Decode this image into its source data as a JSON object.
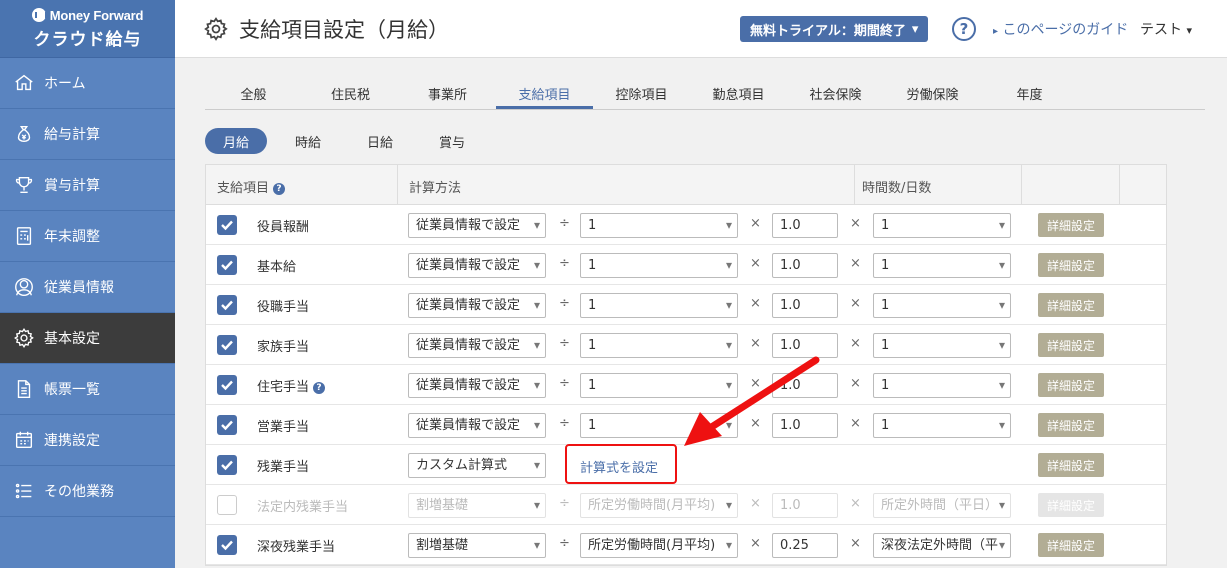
{
  "brand": {
    "logo_text": "Money Forward",
    "product": "クラウド給与"
  },
  "sidebar": {
    "items": [
      {
        "label": "ホーム",
        "icon": "home-icon"
      },
      {
        "label": "給与計算",
        "icon": "money-bag-icon"
      },
      {
        "label": "賞与計算",
        "icon": "trophy-icon"
      },
      {
        "label": "年末調整",
        "icon": "calculator-icon"
      },
      {
        "label": "従業員情報",
        "icon": "person-icon"
      },
      {
        "label": "基本設定",
        "icon": "gear-icon"
      },
      {
        "label": "帳票一覧",
        "icon": "document-icon"
      },
      {
        "label": "連携設定",
        "icon": "calendar-icon"
      },
      {
        "label": "その他業務",
        "icon": "list-icon"
      }
    ],
    "active_index": 5
  },
  "header": {
    "title": "支給項目設定（月給）",
    "trial_label": "無料トライアル：期間終了",
    "help_label": "?",
    "guide_label": "このページのガイド",
    "user_label": "テスト"
  },
  "tabs": [
    "全般",
    "住民税",
    "事業所",
    "支給項目",
    "控除項目",
    "勤怠項目",
    "社会保険",
    "労働保険",
    "年度"
  ],
  "active_tab": 3,
  "subtabs": [
    "月給",
    "時給",
    "日給",
    "賞与"
  ],
  "active_subtab": 0,
  "table": {
    "headers": {
      "item": "支給項目",
      "method": "計算方法",
      "hours": "時間数/日数"
    },
    "detail_label": "詳細設定",
    "formula_label": "計算式を設定",
    "divide_symbol": "÷",
    "times_symbol": "×",
    "rows": [
      {
        "name": "役員報酬",
        "checked": true,
        "help": false,
        "method": "従業員情報で設定",
        "divisor": "1",
        "factor": "1.0",
        "hours": "1"
      },
      {
        "name": "基本給",
        "checked": true,
        "help": false,
        "method": "従業員情報で設定",
        "divisor": "1",
        "factor": "1.0",
        "hours": "1"
      },
      {
        "name": "役職手当",
        "checked": true,
        "help": false,
        "method": "従業員情報で設定",
        "divisor": "1",
        "factor": "1.0",
        "hours": "1"
      },
      {
        "name": "家族手当",
        "checked": true,
        "help": false,
        "method": "従業員情報で設定",
        "divisor": "1",
        "factor": "1.0",
        "hours": "1"
      },
      {
        "name": "住宅手当",
        "checked": true,
        "help": true,
        "method": "従業員情報で設定",
        "divisor": "1",
        "factor": "1.0",
        "hours": "1"
      },
      {
        "name": "営業手当",
        "checked": true,
        "help": false,
        "method": "従業員情報で設定",
        "divisor": "1",
        "factor": "1.0",
        "hours": "1"
      },
      {
        "name": "残業手当",
        "checked": true,
        "help": false,
        "method": "カスタム計算式",
        "custom": true
      },
      {
        "name": "法定内残業手当",
        "checked": false,
        "help": false,
        "disabled": true,
        "method": "割増基礎",
        "divisor": "所定労働時間(月平均)",
        "factor": "1.0",
        "hours": "所定外時間（平日）"
      },
      {
        "name": "深夜残業手当",
        "checked": true,
        "help": false,
        "method": "割増基礎",
        "divisor": "所定労働時間(月平均)",
        "factor": "0.25",
        "hours": "深夜法定外時間（平"
      }
    ]
  },
  "colors": {
    "accent": "#4a6ea8",
    "sidebar": "#5a84c0",
    "annotation": "#e11111",
    "detail_button": "#b2ad95"
  }
}
